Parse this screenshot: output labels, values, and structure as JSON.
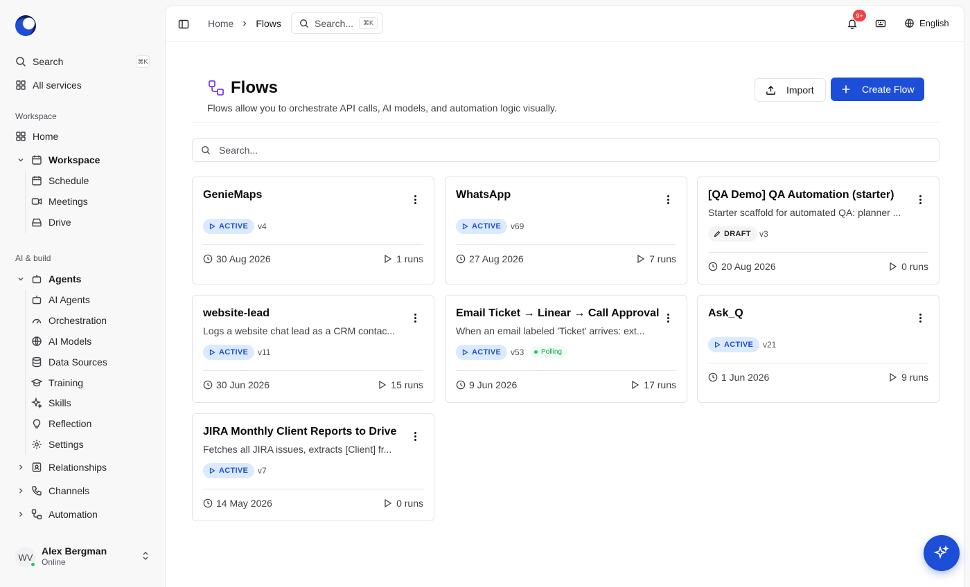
{
  "sidebar": {
    "search_label": "Search",
    "search_shortcut": "⌘K",
    "all_services": "All services",
    "section_workspace": "Workspace",
    "home": "Home",
    "workspace_group": "Workspace",
    "workspace_items": [
      "Schedule",
      "Meetings",
      "Drive"
    ],
    "section_ai": "AI & build",
    "agents_group": "Agents",
    "agents_items": [
      "AI Agents",
      "Orchestration",
      "AI Models",
      "Data Sources",
      "Training",
      "Skills",
      "Reflection",
      "Settings"
    ],
    "relationships": "Relationships",
    "channels": "Channels",
    "automation": "Automation",
    "user": {
      "initials": "WV",
      "name": "Alex Bergman",
      "status": "Online"
    }
  },
  "topbar": {
    "breadcrumb": [
      "Home",
      "Flows"
    ],
    "search_placeholder": "Search...",
    "search_shortcut": "⌘K",
    "notification_count": "9+",
    "language": "English"
  },
  "page": {
    "title": "Flows",
    "subtitle": "Flows allow you to orchestrate API calls, AI models, and automation logic visually.",
    "import_label": "Import",
    "create_label": "Create Flow",
    "search_placeholder": "Search..."
  },
  "flows": [
    {
      "name": "GenieMaps",
      "description": "",
      "status": "ACTIVE",
      "version": "v4",
      "polling": "",
      "date": "30 Aug 2026",
      "runs": "1 runs"
    },
    {
      "name": "WhatsApp",
      "description": "",
      "status": "ACTIVE",
      "version": "v69",
      "polling": "",
      "date": "27 Aug 2026",
      "runs": "7 runs"
    },
    {
      "name": "[QA Demo] QA Automation (starter)",
      "description": "Starter scaffold for automated QA: planner ...",
      "status": "DRAFT",
      "version": "v3",
      "polling": "",
      "date": "20 Aug 2026",
      "runs": "0 runs"
    },
    {
      "name": "website-lead",
      "description": "Logs a website chat lead as a CRM contac...",
      "status": "ACTIVE",
      "version": "v11",
      "polling": "",
      "date": "30 Jun 2026",
      "runs": "15 runs"
    },
    {
      "name": "Email Ticket → Linear → Call Approval",
      "description": "When an email labeled 'Ticket' arrives: ext...",
      "status": "ACTIVE",
      "version": "v53",
      "polling": "Polling",
      "date": "9 Jun 2026",
      "runs": "17 runs"
    },
    {
      "name": "Ask_Q",
      "description": "",
      "status": "ACTIVE",
      "version": "v21",
      "polling": "",
      "date": "1 Jun 2026",
      "runs": "9 runs"
    },
    {
      "name": "JIRA Monthly Client Reports to Drive",
      "description": "Fetches all JIRA issues, extracts [Client] fr...",
      "status": "ACTIVE",
      "version": "v7",
      "polling": "",
      "date": "14 May 2026",
      "runs": "0 runs"
    }
  ],
  "colors": {
    "accent": "#1d4ed8",
    "active_pill_bg": "#dbeafe",
    "notification": "#ef4444",
    "online": "#22c55e"
  }
}
